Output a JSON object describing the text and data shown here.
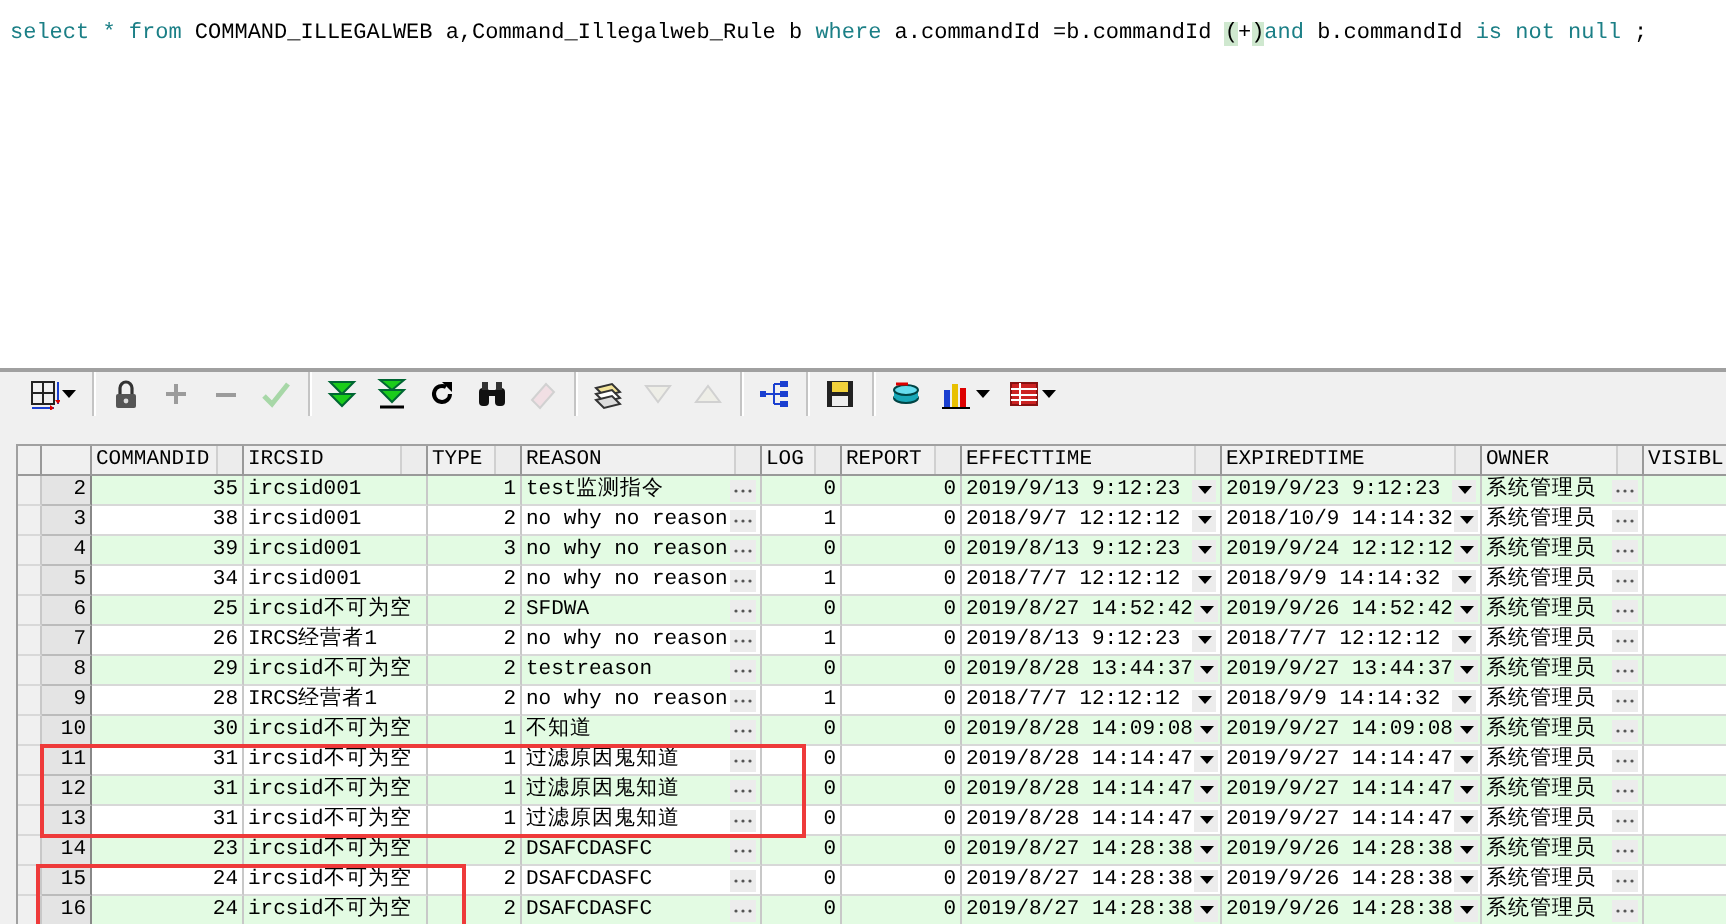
{
  "editor": {
    "tokens": [
      {
        "kind": "keyword",
        "text": "select"
      },
      {
        "kind": "keyword",
        "text": " * "
      },
      {
        "kind": "keyword",
        "text": "from"
      },
      {
        "kind": "plain",
        "text": " COMMAND_ILLEGALWEB a,Command_Illegalweb_Rule b "
      },
      {
        "kind": "keyword",
        "text": "where"
      },
      {
        "kind": "plain",
        "text": " a.commandId =b.commandId "
      },
      {
        "kind": "match",
        "text": "("
      },
      {
        "kind": "plain",
        "text": "+"
      },
      {
        "kind": "match",
        "text": ")"
      },
      {
        "kind": "keyword",
        "text": "and"
      },
      {
        "kind": "plain",
        "text": " b.commandId "
      },
      {
        "kind": "keyword",
        "text": "is not null"
      },
      {
        "kind": "plain",
        "text": " ;"
      }
    ]
  },
  "toolbar": [
    {
      "kind": "grid-view",
      "disabled": false
    },
    {
      "kind": "caret",
      "disabled": false
    },
    {
      "kind": "separator"
    },
    {
      "kind": "lock",
      "disabled": false
    },
    {
      "kind": "plus",
      "disabled": true
    },
    {
      "kind": "minus",
      "disabled": true
    },
    {
      "kind": "check",
      "disabled": true
    },
    {
      "kind": "separator"
    },
    {
      "kind": "fetch-next",
      "disabled": false
    },
    {
      "kind": "fetch-last",
      "disabled": false
    },
    {
      "kind": "refresh",
      "disabled": false
    },
    {
      "kind": "find",
      "disabled": false
    },
    {
      "kind": "eraser",
      "disabled": true
    },
    {
      "kind": "separator"
    },
    {
      "kind": "stack",
      "disabled": false
    },
    {
      "kind": "down",
      "disabled": true
    },
    {
      "kind": "up",
      "disabled": true
    },
    {
      "kind": "separator"
    },
    {
      "kind": "tree",
      "disabled": false
    },
    {
      "kind": "separator"
    },
    {
      "kind": "save",
      "disabled": false
    },
    {
      "kind": "separator"
    },
    {
      "kind": "export",
      "disabled": false
    },
    {
      "kind": "chart",
      "disabled": false
    },
    {
      "kind": "caret",
      "disabled": false
    },
    {
      "kind": "table",
      "disabled": false
    },
    {
      "kind": "caret",
      "disabled": false
    }
  ],
  "table": {
    "columns": [
      {
        "kind": "number",
        "label": "COMMANDID"
      },
      {
        "kind": "text",
        "label": "IRCSID"
      },
      {
        "kind": "number",
        "label": "TYPE"
      },
      {
        "kind": "text-more",
        "label": "REASON"
      },
      {
        "kind": "number",
        "label": "LOG"
      },
      {
        "kind": "number",
        "label": "REPORT"
      },
      {
        "kind": "date",
        "label": "EFFECTTIME"
      },
      {
        "kind": "date",
        "label": "EXPIREDTIME"
      },
      {
        "kind": "text-more",
        "label": "OWNER"
      },
      {
        "kind": "text",
        "label": "VISIBL"
      }
    ],
    "rows": [
      {
        "number": "2",
        "outlined": false,
        "cells": [
          "35",
          "ircsid001",
          "1",
          "test监测指令",
          "0",
          "0",
          "2019/9/13 9:12:23",
          "2019/9/23 9:12:23",
          "系统管理员",
          ""
        ]
      },
      {
        "number": "3",
        "outlined": false,
        "cells": [
          "38",
          "ircsid001",
          "2",
          "no why no reason",
          "1",
          "0",
          "2018/9/7 12:12:12",
          "2018/10/9 14:14:32",
          "系统管理员",
          ""
        ]
      },
      {
        "number": "4",
        "outlined": false,
        "cells": [
          "39",
          "ircsid001",
          "3",
          "no why no reason",
          "0",
          "0",
          "2019/8/13 9:12:23",
          "2019/9/24 12:12:12",
          "系统管理员",
          ""
        ]
      },
      {
        "number": "5",
        "outlined": false,
        "cells": [
          "34",
          "ircsid001",
          "2",
          "no why no reason",
          "1",
          "0",
          "2018/7/7 12:12:12",
          "2018/9/9 14:14:32",
          "系统管理员",
          ""
        ]
      },
      {
        "number": "6",
        "outlined": false,
        "cells": [
          "25",
          "ircsid不可为空",
          "2",
          "SFDWA",
          "0",
          "0",
          "2019/8/27 14:52:42",
          "2019/9/26 14:52:42",
          "系统管理员",
          ""
        ]
      },
      {
        "number": "7",
        "outlined": false,
        "cells": [
          "26",
          "IRCS经营者1",
          "2",
          "no why no reason",
          "1",
          "0",
          "2019/8/13 9:12:23",
          "2018/7/7 12:12:12",
          "系统管理员",
          ""
        ]
      },
      {
        "number": "8",
        "outlined": false,
        "cells": [
          "29",
          "ircsid不可为空",
          "2",
          "testreason",
          "0",
          "0",
          "2019/8/28 13:44:37",
          "2019/9/27 13:44:37",
          "系统管理员",
          ""
        ]
      },
      {
        "number": "9",
        "outlined": false,
        "cells": [
          "28",
          "IRCS经营者1",
          "2",
          "no why no reason",
          "1",
          "0",
          "2018/7/7 12:12:12",
          "2018/9/9 14:14:32",
          "系统管理员",
          ""
        ]
      },
      {
        "number": "10",
        "outlined": false,
        "cells": [
          "30",
          "ircsid不可为空",
          "1",
          "不知道",
          "0",
          "0",
          "2019/8/28 14:09:08",
          "2019/9/27 14:09:08",
          "系统管理员",
          ""
        ]
      },
      {
        "number": "11",
        "outlined": true,
        "cells": [
          "31",
          "ircsid不可为空",
          "1",
          "过滤原因鬼知道",
          "0",
          "0",
          "2019/8/28 14:14:47",
          "2019/9/27 14:14:47",
          "系统管理员",
          ""
        ]
      },
      {
        "number": "12",
        "outlined": true,
        "cells": [
          "31",
          "ircsid不可为空",
          "1",
          "过滤原因鬼知道",
          "0",
          "0",
          "2019/8/28 14:14:47",
          "2019/9/27 14:14:47",
          "系统管理员",
          ""
        ]
      },
      {
        "number": "13",
        "outlined": true,
        "cells": [
          "31",
          "ircsid不可为空",
          "1",
          "过滤原因鬼知道",
          "0",
          "0",
          "2019/8/28 14:14:47",
          "2019/9/27 14:14:47",
          "系统管理员",
          ""
        ]
      },
      {
        "number": "14",
        "outlined": false,
        "cells": [
          "23",
          "ircsid不可为空",
          "2",
          "DSAFCDASFC",
          "0",
          "0",
          "2019/8/27 14:28:38",
          "2019/9/26 14:28:38",
          "系统管理员",
          ""
        ]
      },
      {
        "number": "15",
        "outlined": true,
        "cells": [
          "24",
          "ircsid不可为空",
          "2",
          "DSAFCDASFC",
          "0",
          "0",
          "2019/8/27 14:28:38",
          "2019/9/26 14:28:38",
          "系统管理员",
          ""
        ]
      },
      {
        "number": "16",
        "outlined": true,
        "cells": [
          "24",
          "ircsid不可为空",
          "2",
          "DSAFCDASFC",
          "0",
          "0",
          "2019/8/27 14:28:38",
          "2019/9/26 14:28:38",
          "系统管理员",
          ""
        ]
      }
    ]
  }
}
